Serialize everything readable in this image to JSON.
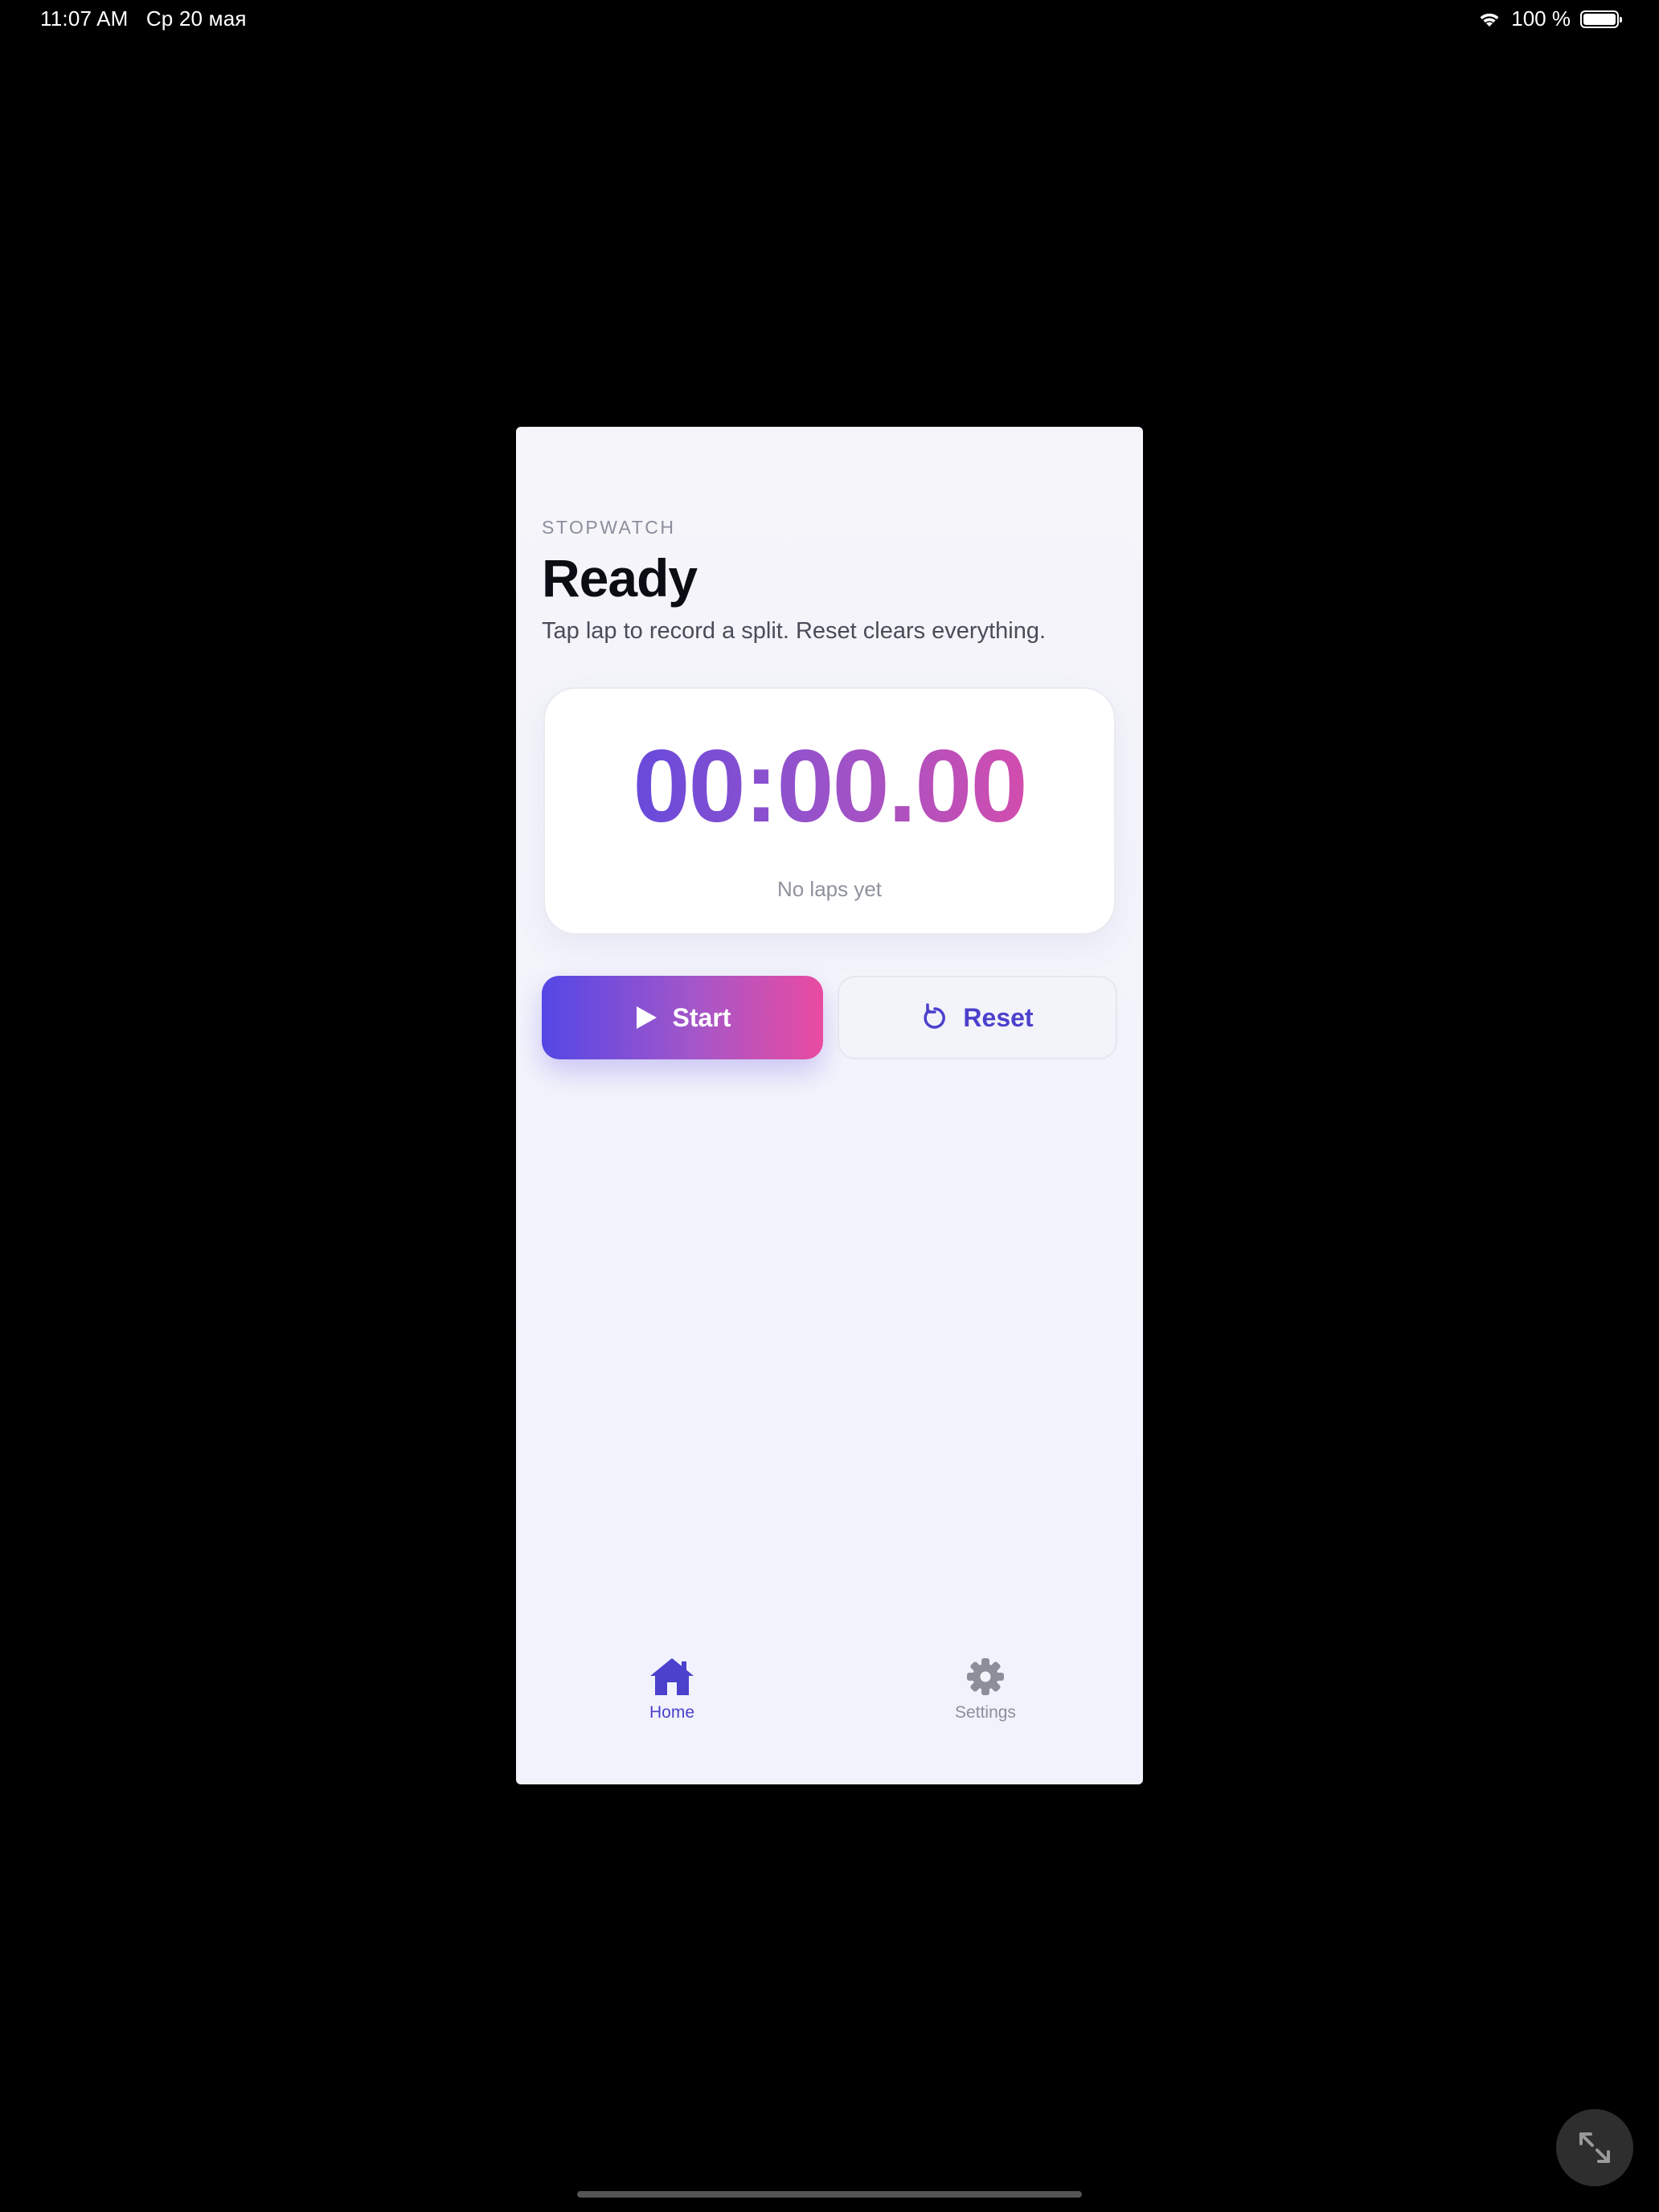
{
  "status_bar": {
    "time": "11:07 AM",
    "date": "Ср 20 мая",
    "battery": "100 %"
  },
  "app": {
    "eyebrow": "STOPWATCH",
    "title": "Ready",
    "subtitle": "Tap lap to record a split. Reset clears everything.",
    "timer": "00:00.00",
    "laps_empty": "No laps yet",
    "start_label": "Start",
    "reset_label": "Reset"
  },
  "tabs": [
    {
      "label": "Home",
      "icon": "home-icon",
      "active": true
    },
    {
      "label": "Settings",
      "icon": "gear-icon",
      "active": false
    }
  ],
  "colors": {
    "accent": "#4b41cc",
    "gradient_start": "#5046e4",
    "gradient_end": "#eb4aa1"
  }
}
